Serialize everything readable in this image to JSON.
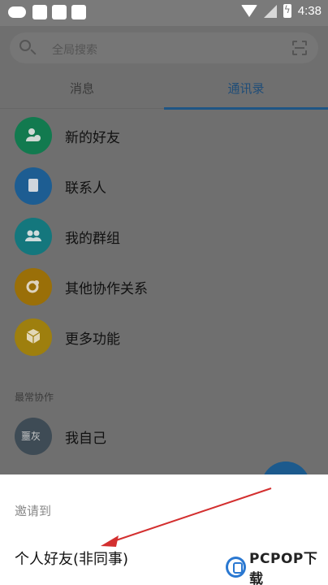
{
  "status_bar": {
    "time": "4:38",
    "icons": [
      "gamepad-icon",
      "notification-square-icon",
      "notification-square-icon",
      "notification-square-icon",
      "wifi-icon",
      "signal-icon",
      "battery-charging-icon"
    ]
  },
  "search": {
    "placeholder": "全局搜索",
    "icon": "search-icon",
    "scan_icon": "scan-icon"
  },
  "tabs": [
    {
      "label": "消息",
      "active": false
    },
    {
      "label": "通讯录",
      "active": true
    }
  ],
  "contacts_menu": [
    {
      "label": "新的好友",
      "icon": "add-person-icon",
      "color": "#127a4f"
    },
    {
      "label": "联系人",
      "icon": "contacts-book-icon",
      "color": "#1d5d92"
    },
    {
      "label": "我的群组",
      "icon": "group-icon",
      "color": "#14777d"
    },
    {
      "label": "其他协作关系",
      "icon": "link-icon",
      "color": "#9a6f08"
    },
    {
      "label": "更多功能",
      "icon": "cube-icon",
      "color": "#9e7f0e"
    }
  ],
  "recent_section": {
    "title": "最常协作",
    "items": [
      {
        "label": "我自己",
        "avatar_text": "噩灰",
        "color": "#3e4b55"
      }
    ]
  },
  "sheet": {
    "title": "邀请到",
    "option": "个人好友(非同事)"
  },
  "watermark": {
    "text": "PCPOP下载"
  },
  "colors": {
    "accent": "#1e5584",
    "annotation_arrow": "#d32f2f"
  }
}
